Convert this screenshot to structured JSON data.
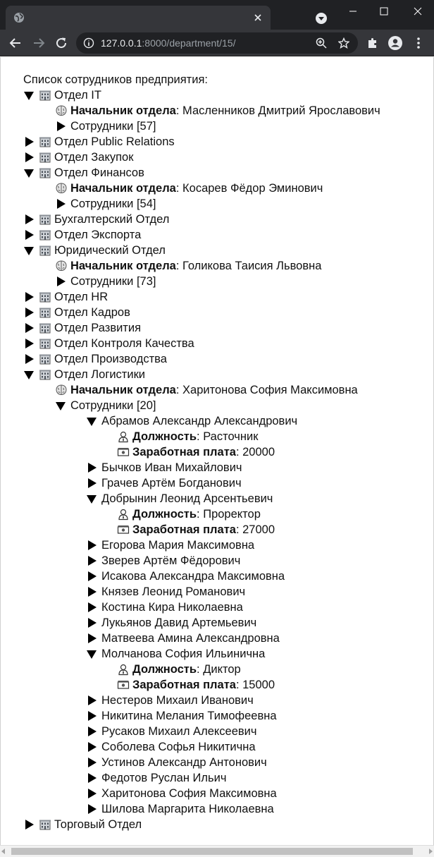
{
  "browser": {
    "url_host": "127.0.0.1",
    "url_rest": ":8000/department/15/"
  },
  "page": {
    "heading": "Список сотрудников предприятия:",
    "head_label": "Начальник отдела",
    "employees_label": "Сотрудники",
    "position_label": "Должность",
    "salary_label": "Заработная плата",
    "departments": [
      {
        "name": "Отдел IT",
        "expanded": true,
        "head": "Масленников Дмитрий Ярославович",
        "count_text": "[57]"
      },
      {
        "name": "Отдел Public Relations",
        "expanded": false
      },
      {
        "name": "Отдел Закупок",
        "expanded": false
      },
      {
        "name": "Отдел Финансов",
        "expanded": true,
        "head": "Косарев Фёдор Эминович",
        "count_text": "[54]"
      },
      {
        "name": "Бухгалтерский Отдел",
        "expanded": false
      },
      {
        "name": "Отдел Экспорта",
        "expanded": false
      },
      {
        "name": "Юридический Отдел",
        "expanded": true,
        "head": "Голикова Таисия Львовна",
        "count_text": "[73]"
      },
      {
        "name": "Отдел HR",
        "expanded": false
      },
      {
        "name": "Отдел Кадров",
        "expanded": false
      },
      {
        "name": "Отдел Развития",
        "expanded": false
      },
      {
        "name": "Отдел Контроля Качества",
        "expanded": false
      },
      {
        "name": "Отдел Производства",
        "expanded": false
      },
      {
        "name": "Отдел Логистики",
        "expanded": true,
        "head": "Харитонова София Максимовна",
        "count_text": "[20]",
        "employees_expanded": true,
        "employees": [
          {
            "name": "Абрамов Александр Александрович",
            "expanded": true,
            "position": "Расточник",
            "salary": "20000"
          },
          {
            "name": "Бычков Иван Михайлович",
            "expanded": false
          },
          {
            "name": "Грачев Артём Богданович",
            "expanded": false
          },
          {
            "name": "Добрынин Леонид Арсентьевич",
            "expanded": true,
            "position": "Проректор",
            "salary": "27000"
          },
          {
            "name": "Егорова Мария Максимовна",
            "expanded": false
          },
          {
            "name": "Зверев Артём Фёдорович",
            "expanded": false
          },
          {
            "name": "Исакова Александра Максимовна",
            "expanded": false
          },
          {
            "name": "Князев Леонид Романович",
            "expanded": false
          },
          {
            "name": "Костина Кира Николаевна",
            "expanded": false
          },
          {
            "name": "Лукьянов Давид Артемьевич",
            "expanded": false
          },
          {
            "name": "Матвеева Амина Александровна",
            "expanded": false
          },
          {
            "name": "Молчанова София Ильинична",
            "expanded": true,
            "position": "Диктор",
            "salary": "15000"
          },
          {
            "name": "Нестеров Михаил Иванович",
            "expanded": false
          },
          {
            "name": "Никитина Мелания Тимофеевна",
            "expanded": false
          },
          {
            "name": "Русаков Михаил Алексеевич",
            "expanded": false
          },
          {
            "name": "Соболева Софья Никитична",
            "expanded": false
          },
          {
            "name": "Устинов Александр Антонович",
            "expanded": false
          },
          {
            "name": "Федотов Руслан Ильич",
            "expanded": false
          },
          {
            "name": "Харитонова София Максимовна",
            "expanded": false
          },
          {
            "name": "Шилова Маргарита Николаевна",
            "expanded": false
          }
        ]
      },
      {
        "name": "Торговый Отдел",
        "expanded": false
      }
    ]
  },
  "icons": {
    "department": "building-icon",
    "head": "brain-icon",
    "position": "person-icon",
    "salary": "money-icon"
  }
}
